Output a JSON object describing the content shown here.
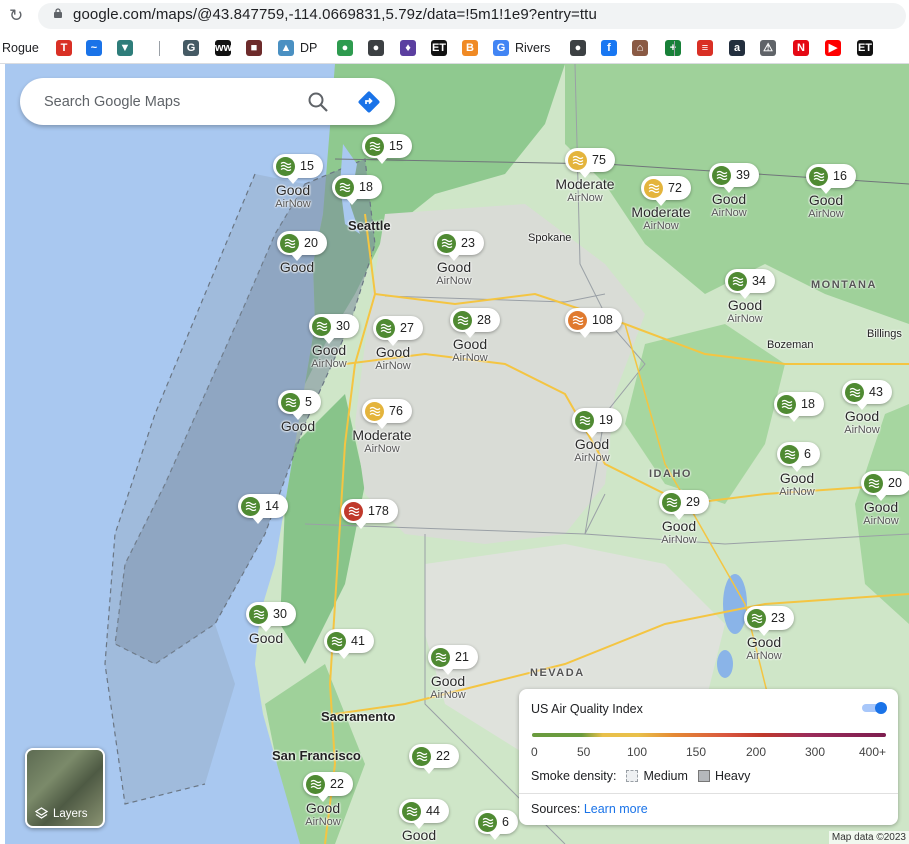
{
  "browser": {
    "url": "google.com/maps/@43.847759,-114.0669831,5.79z/data=!5m1!1e9?entry=ttu",
    "bookmarks": [
      {
        "label": "Rogue",
        "icon": "",
        "color": ""
      },
      {
        "label": "",
        "icon": "T",
        "color": "#d93025"
      },
      {
        "label": "",
        "icon": "~",
        "color": "#1a73e8"
      },
      {
        "label": "",
        "icon": "▼",
        "color": "#2e7d7a"
      },
      {
        "label": "",
        "icon": "G",
        "color": "#455a64"
      },
      {
        "label": "",
        "icon": "ww",
        "color": "#111111"
      },
      {
        "label": "",
        "icon": "■",
        "color": "#6d2b2b"
      },
      {
        "label": "DP",
        "icon": "▲",
        "color": "#4a90c2"
      },
      {
        "label": "",
        "icon": "●",
        "color": "#2e9b4f"
      },
      {
        "label": "",
        "icon": "●",
        "color": "#3c4043"
      },
      {
        "label": "",
        "icon": "♦",
        "color": "#5b3fa0"
      },
      {
        "label": "",
        "icon": "ET",
        "color": "#111111"
      },
      {
        "label": "",
        "icon": "B",
        "color": "#f08a24"
      },
      {
        "label": "Rivers",
        "icon": "G",
        "color": "#4285f4"
      },
      {
        "label": "",
        "icon": "●",
        "color": "#3c4043"
      },
      {
        "label": "",
        "icon": "f",
        "color": "#1877f2"
      },
      {
        "label": "",
        "icon": "⌂",
        "color": "#8a5a44"
      },
      {
        "label": "",
        "icon": "+",
        "color": "#188038"
      },
      {
        "label": "",
        "icon": "≡",
        "color": "#d93025"
      },
      {
        "label": "",
        "icon": "a",
        "color": "#232f3e"
      },
      {
        "label": "",
        "icon": "⚠",
        "color": "#5f6368"
      },
      {
        "label": "",
        "icon": "N",
        "color": "#e50914"
      },
      {
        "label": "",
        "icon": "▶",
        "color": "#ff0000"
      },
      {
        "label": "",
        "icon": "ET",
        "color": "#111111"
      }
    ]
  },
  "search": {
    "placeholder": "Search Google Maps"
  },
  "cities": [
    {
      "name": "Seattle",
      "big": true
    },
    {
      "name": "Spokane",
      "big": false
    },
    {
      "name": "Billings",
      "big": false
    },
    {
      "name": "Bozeman",
      "big": false
    },
    {
      "name": "Sacramento",
      "big": true
    },
    {
      "name": "San Francisco",
      "big": true
    }
  ],
  "regions": [
    "MONTANA",
    "IDAHO",
    "NEVADA"
  ],
  "aqi_colors": {
    "good": "#4f8a32",
    "moderate": "#e4b43c",
    "usg": "#e07a2e",
    "unhealthy": "#c0392b"
  },
  "pins": [
    {
      "value": "15",
      "level": "good",
      "category": "",
      "source": ""
    },
    {
      "value": "15",
      "level": "good",
      "category": "Good",
      "source": "AirNow"
    },
    {
      "value": "18",
      "level": "good",
      "category": "",
      "source": ""
    },
    {
      "value": "75",
      "level": "moderate",
      "category": "Moderate",
      "source": "AirNow"
    },
    {
      "value": "72",
      "level": "moderate",
      "category": "Moderate",
      "source": "AirNow"
    },
    {
      "value": "39",
      "level": "good",
      "category": "Good",
      "source": "AirNow"
    },
    {
      "value": "16",
      "level": "good",
      "category": "Good",
      "source": "AirNow"
    },
    {
      "value": "20",
      "level": "good",
      "category": "Good",
      "source": ""
    },
    {
      "value": "23",
      "level": "good",
      "category": "Good",
      "source": "AirNow"
    },
    {
      "value": "34",
      "level": "good",
      "category": "Good",
      "source": "AirNow"
    },
    {
      "value": "30",
      "level": "good",
      "category": "Good",
      "source": "AirNow"
    },
    {
      "value": "27",
      "level": "good",
      "category": "Good",
      "source": "AirNow"
    },
    {
      "value": "28",
      "level": "good",
      "category": "Good",
      "source": "AirNow"
    },
    {
      "value": "108",
      "level": "usg",
      "category": "",
      "source": ""
    },
    {
      "value": "5",
      "level": "good",
      "category": "Good",
      "source": ""
    },
    {
      "value": "76",
      "level": "moderate",
      "category": "Moderate",
      "source": "AirNow"
    },
    {
      "value": "19",
      "level": "good",
      "category": "Good",
      "source": "AirNow"
    },
    {
      "value": "18",
      "level": "good",
      "category": "",
      "source": ""
    },
    {
      "value": "43",
      "level": "good",
      "category": "Good",
      "source": "AirNow"
    },
    {
      "value": "6",
      "level": "good",
      "category": "Good",
      "source": "AirNow"
    },
    {
      "value": "20",
      "level": "good",
      "category": "Good",
      "source": "AirNow"
    },
    {
      "value": "14",
      "level": "good",
      "category": "",
      "source": ""
    },
    {
      "value": "178",
      "level": "unhealthy",
      "category": "",
      "source": ""
    },
    {
      "value": "29",
      "level": "good",
      "category": "Good",
      "source": "AirNow"
    },
    {
      "value": "30",
      "level": "good",
      "category": "Good",
      "source": ""
    },
    {
      "value": "41",
      "level": "good",
      "category": "",
      "source": ""
    },
    {
      "value": "21",
      "level": "good",
      "category": "Good",
      "source": "AirNow"
    },
    {
      "value": "23",
      "level": "good",
      "category": "Good",
      "source": "AirNow"
    },
    {
      "value": "22",
      "level": "good",
      "category": "",
      "source": ""
    },
    {
      "value": "22",
      "level": "good",
      "category": "Good",
      "source": "AirNow"
    },
    {
      "value": "44",
      "level": "good",
      "category": "Good",
      "source": ""
    },
    {
      "value": "6",
      "level": "good",
      "category": "",
      "source": ""
    }
  ],
  "layers": {
    "label": "Layers"
  },
  "legend": {
    "title": "US Air Quality Index",
    "toggle_on": true,
    "ticks": [
      "0",
      "50",
      "100",
      "150",
      "200",
      "300",
      "400+"
    ],
    "smoke_label": "Smoke density:",
    "smoke_medium": "Medium",
    "smoke_heavy": "Heavy",
    "sources_label": "Sources:",
    "sources_link": "Learn more"
  },
  "attribution": "Map data ©2023"
}
